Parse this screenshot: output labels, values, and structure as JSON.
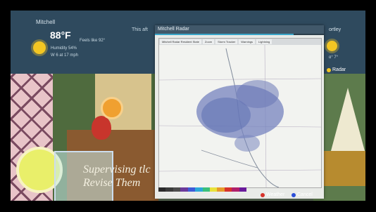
{
  "weather": {
    "left_location": "Mitchell",
    "left_temp": "88°F",
    "left_feels": "Feels like 92°",
    "left_humidity": "Humidity 54%",
    "left_wind": "W 6 at 17 mph",
    "center_label": "This aft",
    "right_location": "ortley",
    "right_small": "ɑ° 7°",
    "radar_link": "Radar"
  },
  "radar": {
    "title": "Mitchell Radar",
    "progress": 0.82,
    "toolbar": [
      "Mitchell Radar Resident State",
      "Zoom",
      "Storm Tracker",
      "Warnings",
      "Lightning"
    ],
    "legend_colors": [
      "#2b2b2b",
      "#3c3c3c",
      "#4d4d4d",
      "#6b3a9a",
      "#3d5bd8",
      "#2ca7d8",
      "#3ac07a",
      "#e8e23a",
      "#e79a2a",
      "#d6332b",
      "#b01f6a",
      "#6a1a9a"
    ],
    "buttons": {
      "weather_label": "Weather",
      "weather_color": "#d6332b",
      "cancel_label": "Cancel",
      "cancel_color": "#2c4fd8"
    }
  },
  "background": {
    "text_line1": "Supervising tlc",
    "text_line2": "Revise Them"
  }
}
